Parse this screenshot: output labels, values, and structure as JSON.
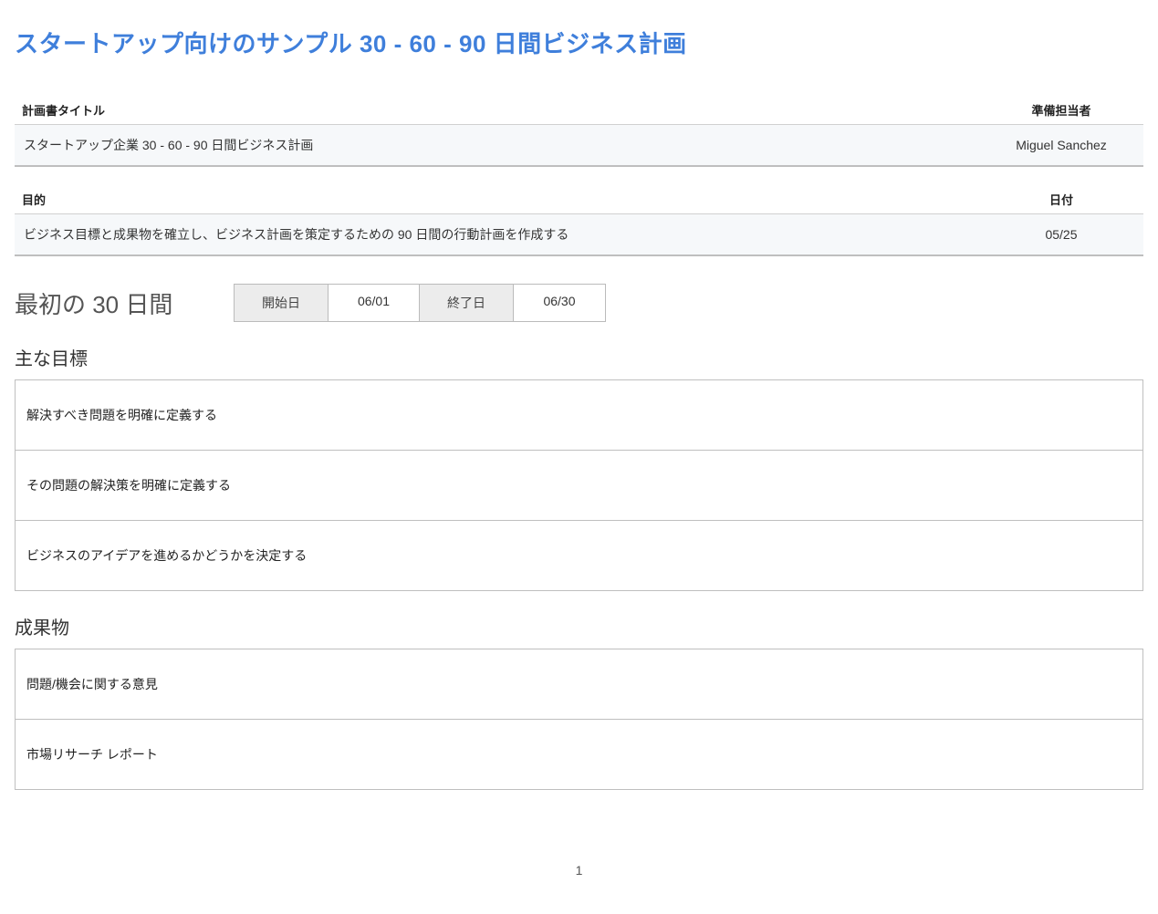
{
  "title": "スタートアップ向けのサンプル 30 - 60 - 90 日間ビジネス計画",
  "header_table": {
    "plan_title_label": "計画書タイトル",
    "plan_title_value": "スタートアップ企業 30 - 60 - 90 日間ビジネス計画",
    "prepared_by_label": "準備担当者",
    "prepared_by_value": "Miguel Sanchez",
    "objective_label": "目的",
    "objective_value": "ビジネス目標と成果物を確立し、ビジネス計画を策定するための 90 日間の行動計画を作成する",
    "date_label": "日付",
    "date_value": "05/25"
  },
  "period": {
    "heading": "最初の 30 日間",
    "start_label": "開始日",
    "start_value": "06/01",
    "end_label": "終了日",
    "end_value": "06/30"
  },
  "goals": {
    "heading": "主な目標",
    "items": [
      "解決すべき問題を明確に定義する",
      "その問題の解決策を明確に定義する",
      "ビジネスのアイデアを進めるかどうかを決定する"
    ]
  },
  "deliverables": {
    "heading": "成果物",
    "items": [
      "問題/機会に関する意見",
      "市場リサーチ レポート"
    ]
  },
  "page_number": "1"
}
